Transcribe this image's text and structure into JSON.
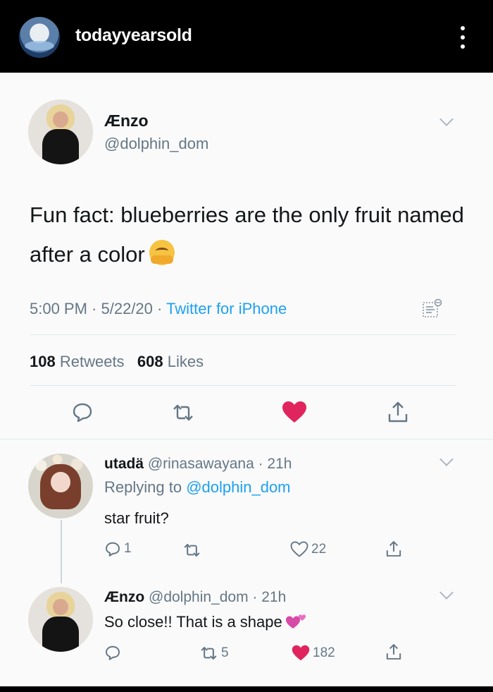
{
  "header": {
    "username": "todayyearsold"
  },
  "tweet": {
    "author_name": "Ænzo",
    "author_handle": "@dolphin_dom",
    "text": "Fun fact: blueberries are the only fruit named after a color",
    "time": "5:00 PM · 5/22/20 · ",
    "source": "Twitter for iPhone",
    "retweets_count": "108",
    "retweets_label": "Retweets",
    "likes_count": "608",
    "likes_label": "Likes"
  },
  "replies": [
    {
      "author_name": "utadä",
      "meta": "@rinasawayana · 21h",
      "replying_prefix": "Replying to ",
      "replying_handle": "@dolphin_dom",
      "text": "star fruit?",
      "reply_count": "1",
      "retweet_count": "",
      "like_count": "22"
    },
    {
      "author_name": "Ænzo",
      "meta": "@dolphin_dom · 21h",
      "text": "So close!! That is a shape",
      "reply_count": "",
      "retweet_count": "5",
      "like_count": "182"
    }
  ],
  "colors": {
    "accent": "#1da1f2",
    "like_red": "#e0245e",
    "muted": "#657786"
  }
}
